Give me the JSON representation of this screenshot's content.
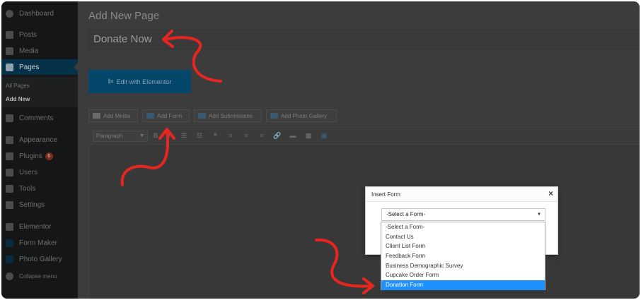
{
  "sidebar": {
    "items": [
      {
        "label": "Dashboard",
        "icon": "dashboard-icon"
      },
      {
        "label": "Posts",
        "icon": "pin-icon"
      },
      {
        "label": "Media",
        "icon": "media-icon"
      },
      {
        "label": "Pages",
        "icon": "pages-icon",
        "active": true
      },
      {
        "label": "Comments",
        "icon": "comment-icon"
      },
      {
        "label": "Appearance",
        "icon": "brush-icon"
      },
      {
        "label": "Plugins",
        "icon": "plugin-icon"
      },
      {
        "label": "Users",
        "icon": "users-icon"
      },
      {
        "label": "Tools",
        "icon": "wrench-icon"
      },
      {
        "label": "Settings",
        "icon": "settings-icon"
      },
      {
        "label": "Elementor",
        "icon": "elementor-icon"
      },
      {
        "label": "Form Maker",
        "icon": "form-maker-icon"
      },
      {
        "label": "Photo Gallery",
        "icon": "gallery-icon"
      },
      {
        "label": "Collapse menu",
        "icon": "collapse-icon"
      }
    ],
    "submenu": {
      "all_pages": "All Pages",
      "add_new": "Add New"
    },
    "plugins_badge": "6"
  },
  "main": {
    "heading": "Add New Page",
    "title_value": "Donate Now",
    "elementor_label": "Edit with Elementor",
    "media_buttons": [
      "Add Media",
      "Add Form",
      "Add Submissions",
      "Add Photo Gallery"
    ],
    "format_select": "Paragraph",
    "toolbar_glyphs": [
      "B",
      "I",
      "☰",
      "☷",
      "❝",
      "≡",
      "≡",
      "≡",
      "🔗",
      "▬",
      "▦",
      "▣"
    ]
  },
  "modal": {
    "title": "Insert Form",
    "close": "×",
    "select_value": "-Select a Form-",
    "caret": "▼",
    "options": [
      "-Select a Form-",
      "Contact Us",
      "Client List Form",
      "Feedback Form",
      "Business Demographic Survey",
      "Cupcake Order Form",
      "Donation Form"
    ],
    "selected_option": "Donation Form"
  },
  "colors": {
    "annotation_arrow": "#e8261f",
    "selected_option_bg": "#1e90ff",
    "active_menu_bg": "#053149",
    "elementor_button": "#04476b"
  }
}
